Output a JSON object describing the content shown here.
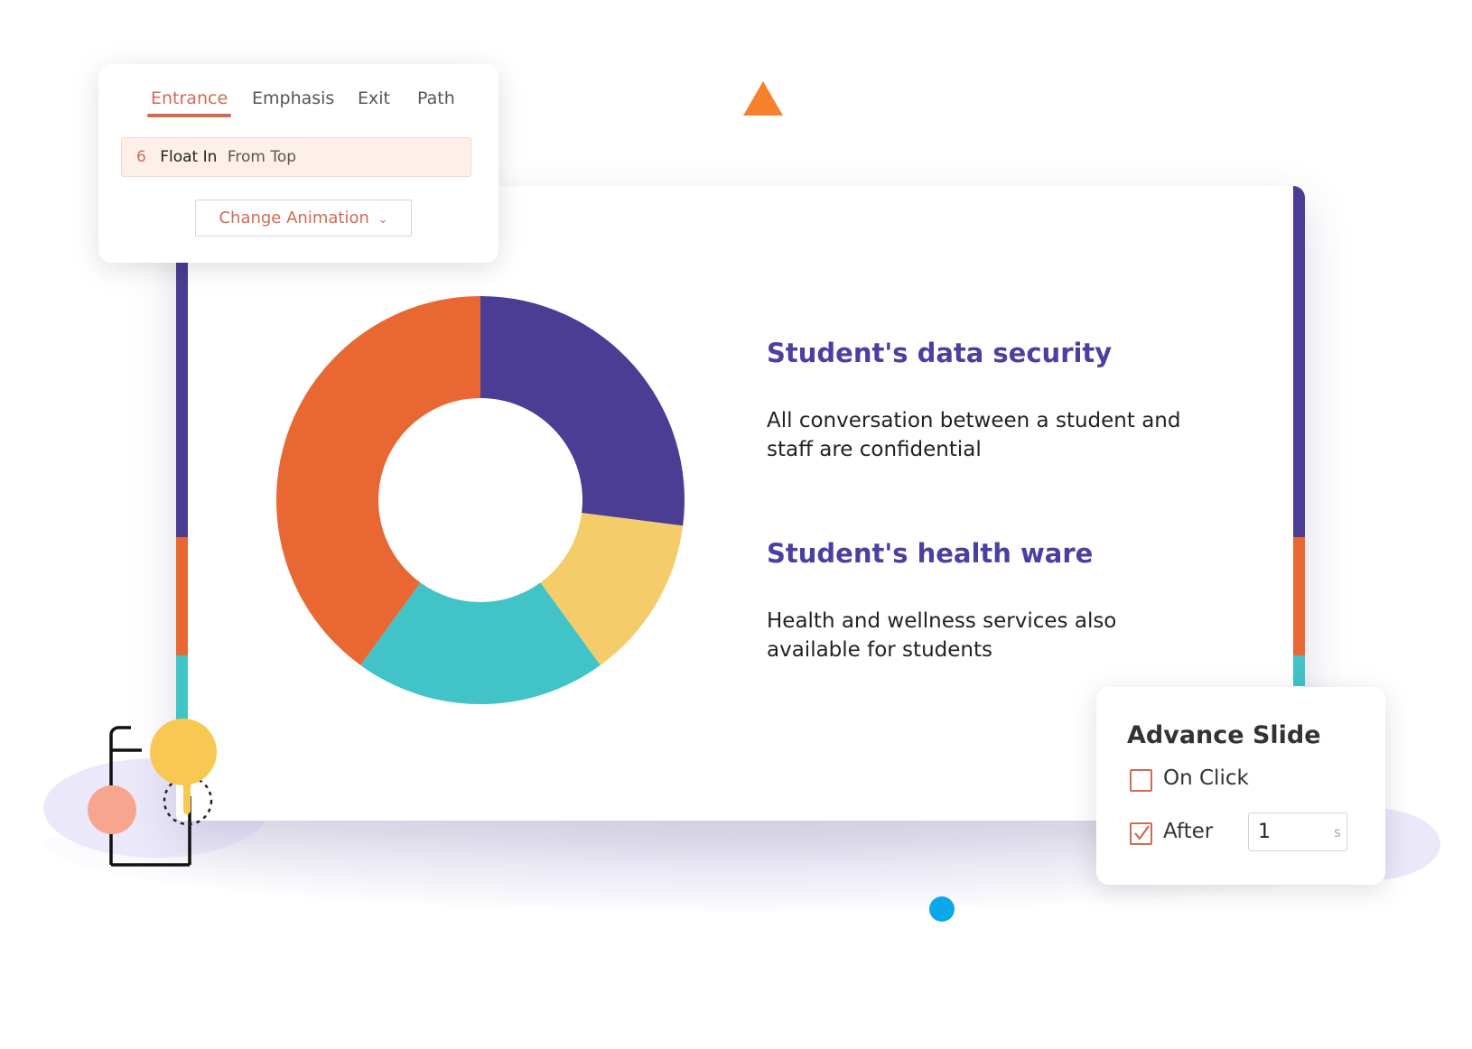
{
  "animation_panel": {
    "tabs": [
      {
        "label": "Entrance",
        "active": true
      },
      {
        "label": "Emphasis",
        "active": false
      },
      {
        "label": "Exit",
        "active": false
      },
      {
        "label": "Path",
        "active": false
      }
    ],
    "selected": {
      "number": "6",
      "name": "Float In",
      "direction": "From Top"
    },
    "change_button": "Change Animation",
    "chevron_icon": "chevron-down-icon"
  },
  "slide": {
    "sections": [
      {
        "title": "Student's data security",
        "body": "All conversation between a student and staff are confidential"
      },
      {
        "title": "Student's health ware",
        "body": "Health and wellness services also available for students"
      }
    ]
  },
  "chart_data": {
    "type": "pie",
    "variant": "donut",
    "values": [
      27,
      13,
      20,
      40
    ],
    "colors": [
      "#4a3d93",
      "#f4cd6a",
      "#42c3c8",
      "#e96733"
    ]
  },
  "advance_panel": {
    "title": "Advance Slide",
    "on_click": {
      "label": "On Click",
      "checked": false
    },
    "after": {
      "label": "After",
      "checked": true,
      "value": "1",
      "unit": "s"
    }
  },
  "colors": {
    "accent": "#d06b52",
    "purple": "#4a3d93",
    "orange": "#e96733",
    "teal": "#42c3c8",
    "yellow": "#f9c853"
  }
}
